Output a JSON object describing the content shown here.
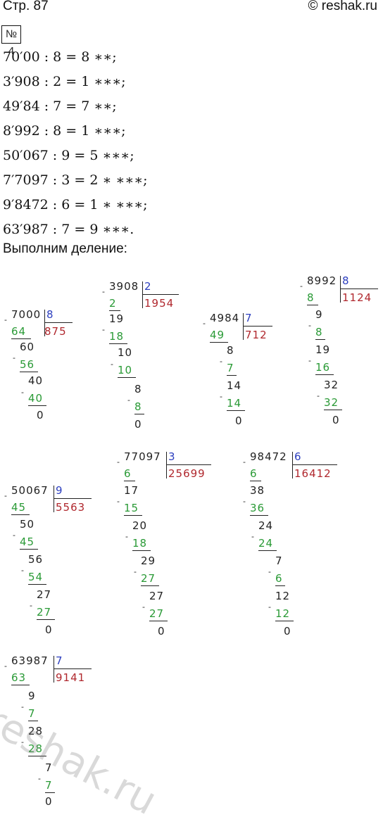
{
  "header": {
    "page": "Стр. 87",
    "site": "© reshak.ru"
  },
  "task_number": "№ 4",
  "equations": [
    "70′00 : 8 = 8 ∗∗;",
    "3′908 : 2 = 1 ∗∗∗;",
    "49′84 : 7 = 7 ∗∗;",
    "8′992 : 8 = 1 ∗∗∗;",
    "50′067 : 9 = 5 ∗∗∗;",
    "7′7097 : 3 = 2 ∗ ∗∗∗;",
    "9′8472 : 6 = 1 ∗ ∗∗∗;",
    "63′987 : 7 = 9 ∗∗∗."
  ],
  "caption": "Выполним деление:",
  "divisions": [
    {
      "dividend": "7000",
      "divisor": "8",
      "quotient": "875",
      "steps": [
        "64",
        "60",
        "56",
        "40",
        "40",
        "0"
      ]
    },
    {
      "dividend": "3908",
      "divisor": "2",
      "quotient": "1954",
      "steps": [
        "2",
        "19",
        "18",
        "10",
        "10",
        "8",
        "8",
        "0"
      ]
    },
    {
      "dividend": "4984",
      "divisor": "7",
      "quotient": "712",
      "steps": [
        "49",
        "8",
        "7",
        "14",
        "14",
        "0"
      ]
    },
    {
      "dividend": "8992",
      "divisor": "8",
      "quotient": "1124",
      "steps": [
        "8",
        "9",
        "8",
        "19",
        "16",
        "32",
        "32",
        "0"
      ]
    },
    {
      "dividend": "50067",
      "divisor": "9",
      "quotient": "5563",
      "steps": [
        "45",
        "50",
        "45",
        "56",
        "54",
        "27",
        "27",
        "0"
      ]
    },
    {
      "dividend": "77097",
      "divisor": "3",
      "quotient": "25699",
      "steps": [
        "6",
        "17",
        "15",
        "20",
        "18",
        "29",
        "27",
        "27",
        "27",
        "0"
      ]
    },
    {
      "dividend": "98472",
      "divisor": "6",
      "quotient": "16412",
      "steps": [
        "6",
        "38",
        "36",
        "24",
        "24",
        "7",
        "6",
        "12",
        "12",
        "0"
      ]
    },
    {
      "dividend": "63987",
      "divisor": "7",
      "quotient": "9141",
      "steps": [
        "63",
        "9",
        "7",
        "28",
        "28",
        "7",
        "7",
        "0"
      ]
    }
  ],
  "watermark": "reshak.ru"
}
